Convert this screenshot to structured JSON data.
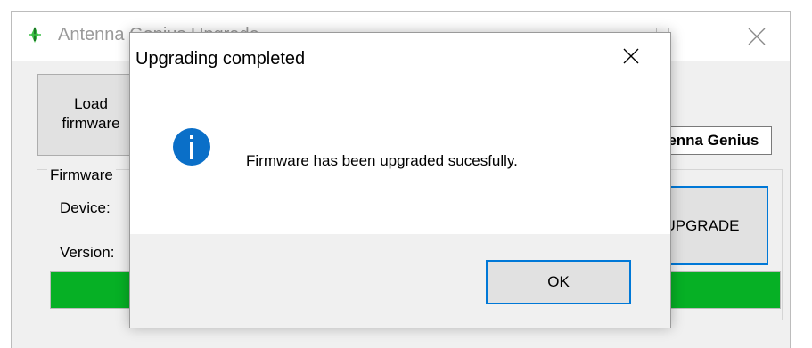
{
  "main_window": {
    "title": "Antenna Genius Upgrade",
    "icon": "antenna-genius-icon",
    "controls": [
      "minimize-icon",
      "maximize-icon",
      "close-icon"
    ],
    "load_button_label": "Load\nfirmware",
    "device_name_value": "Antenna Genius",
    "firmware_group_label": "Firmware",
    "device_label": "Device:",
    "version_label": "Version:",
    "upgrade_button_label": "UPGRADE",
    "progress_percent": 100
  },
  "dialog": {
    "title": "Upgrading completed",
    "icon": "info-icon",
    "message": "Firmware has been upgraded sucesfully.",
    "ok_label": "OK"
  },
  "colors": {
    "accent_blue": "#0078d7",
    "progress_green": "#06b025",
    "app_icon_green": "#3bbf45"
  }
}
